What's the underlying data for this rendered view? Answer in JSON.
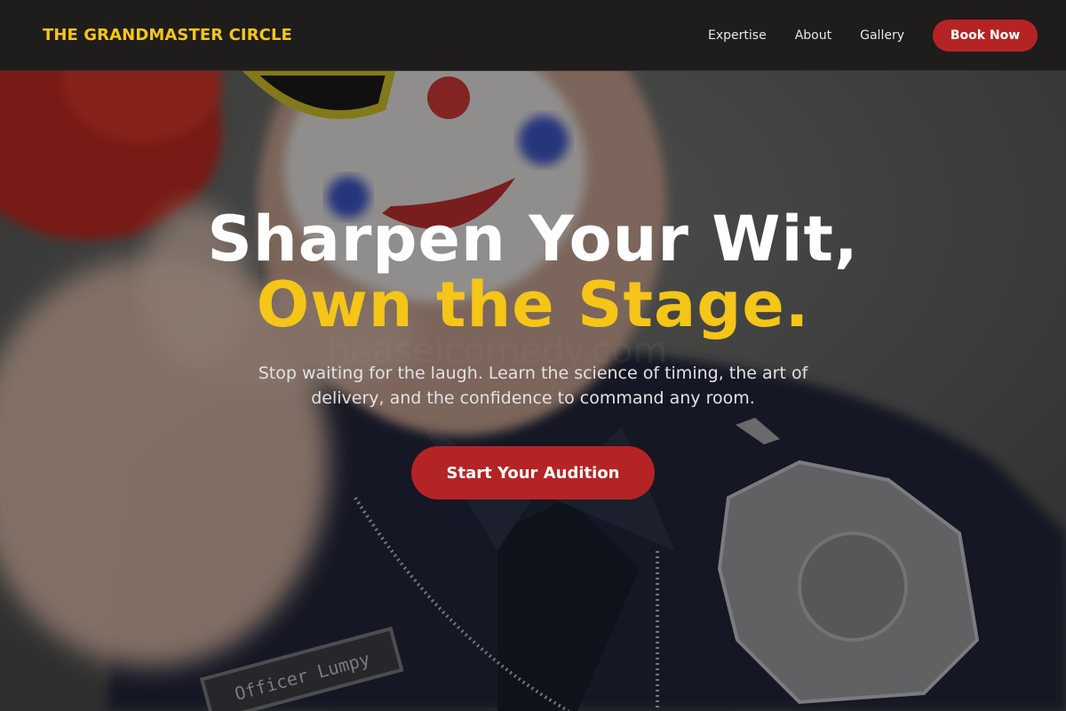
{
  "nav": {
    "brand": "THE GRANDMASTER CIRCLE",
    "links": [
      "Expertise",
      "About",
      "Gallery"
    ],
    "cta_label": "Book Now"
  },
  "hero": {
    "headline_line1": "Sharpen Your Wit,",
    "headline_line2": "Own the Stage.",
    "subtitle": "Stop waiting for the laugh. Learn the science of timing, the art of delivery, and the confidence to command any room.",
    "cta_label": "Start Your Audition",
    "background_image": {
      "name_tag_text": "Officer Lumpy",
      "watermark_text": "heaseicomedy.com"
    }
  },
  "colors": {
    "accent_yellow": "#f5c518",
    "accent_red": "#b52424",
    "nav_background": "#1f1c1c"
  }
}
